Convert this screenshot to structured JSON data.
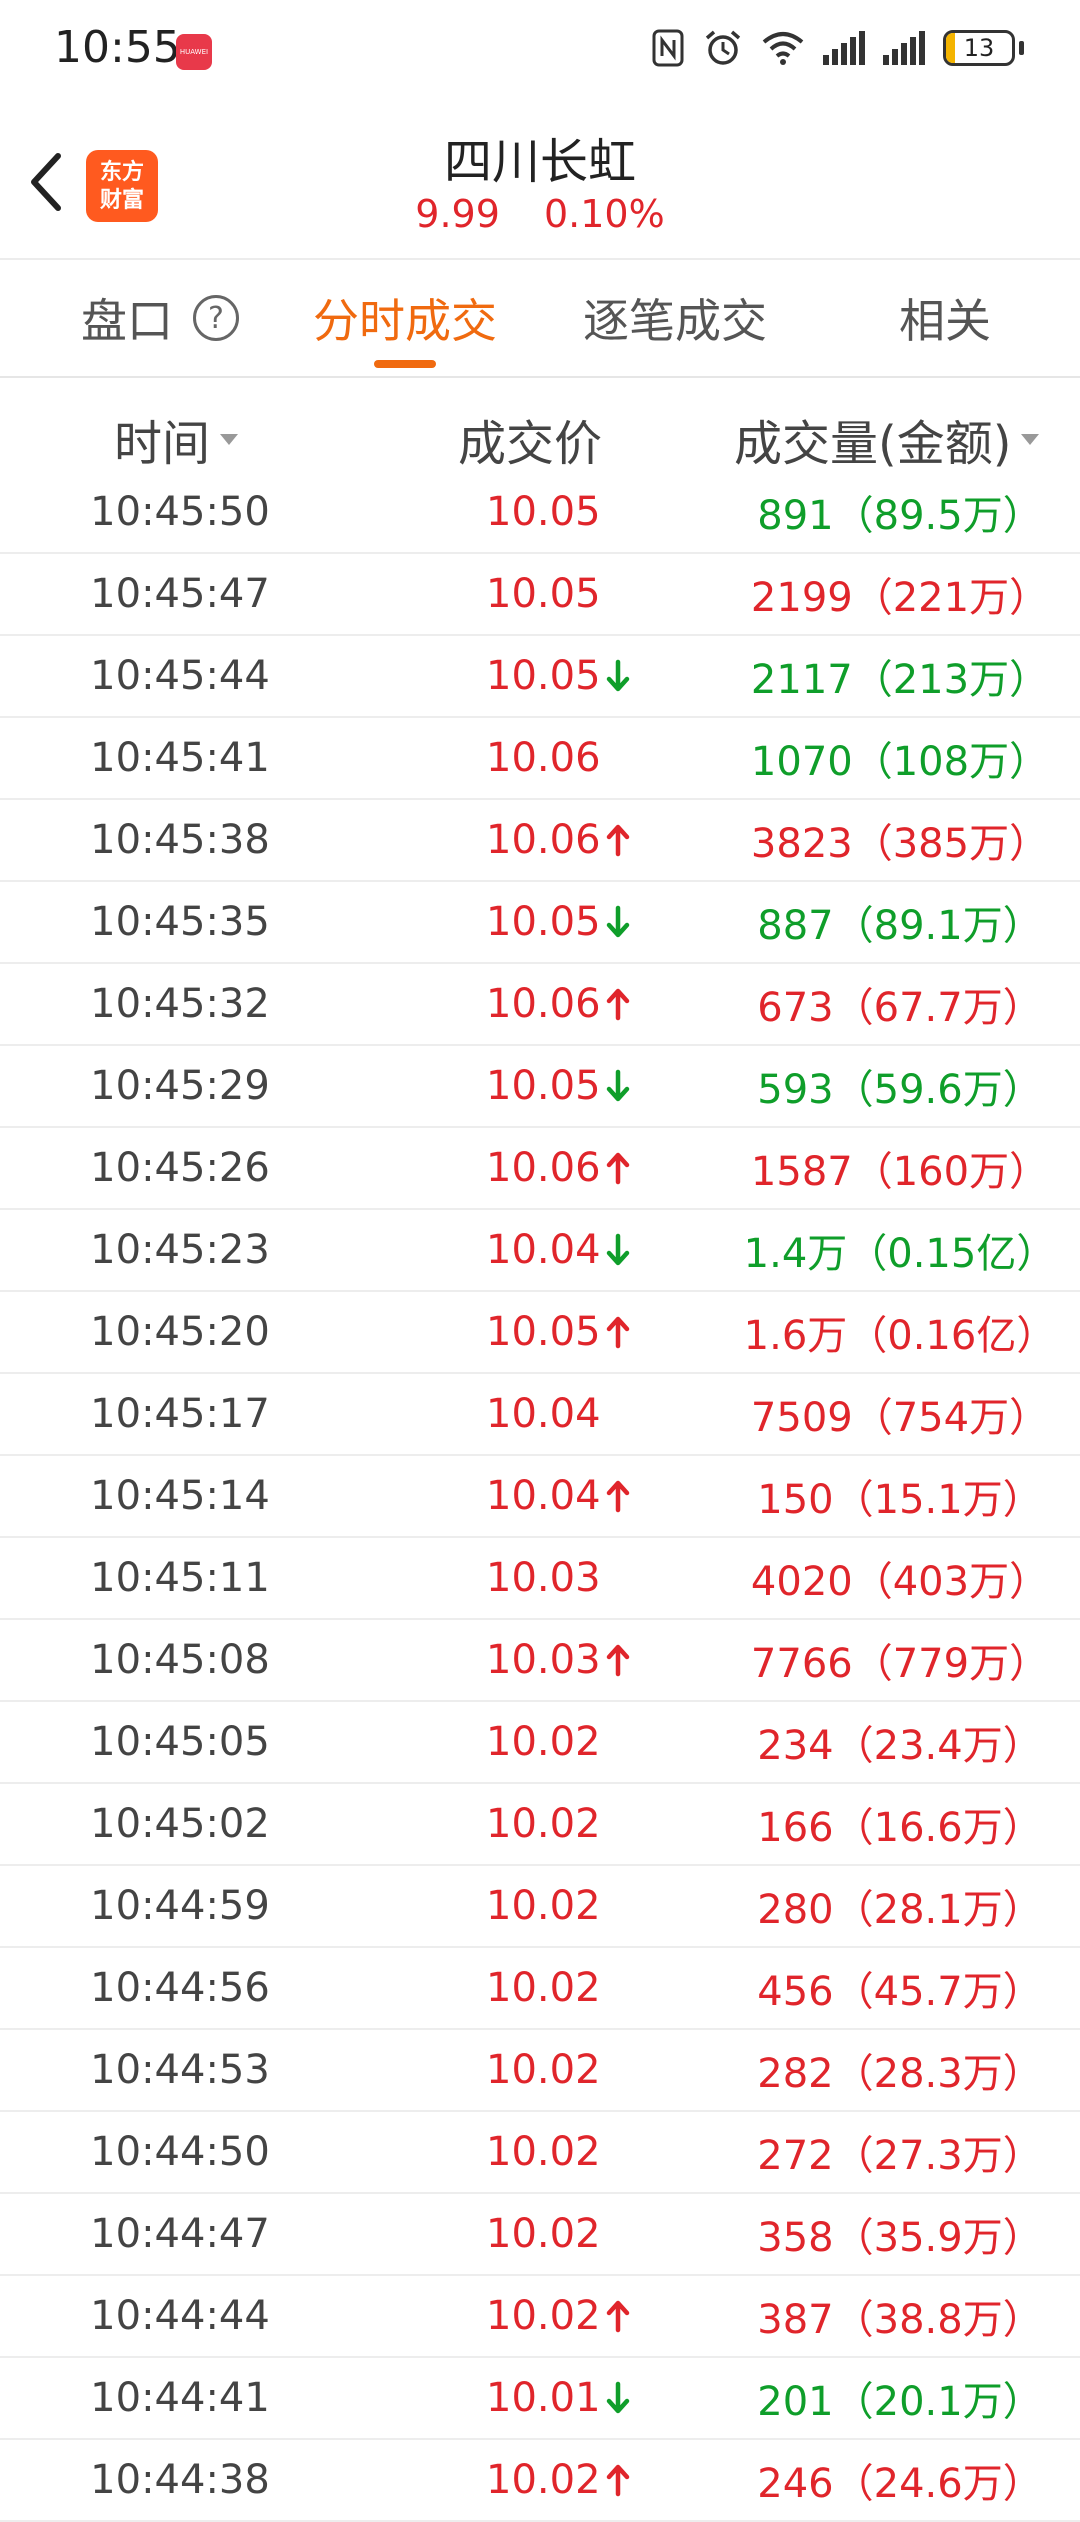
{
  "status_bar": {
    "time": "10:55",
    "huawei_badge": "HUAWEI",
    "battery": "13",
    "battery_level": 0.13
  },
  "header": {
    "logo_line1": "东方",
    "logo_line2": "财富",
    "stock_name": "四川长虹",
    "price": "9.99",
    "change_pct": "0.10%"
  },
  "tabs": [
    {
      "label": "盘口",
      "active": false
    },
    {
      "label": "分时成交",
      "active": true
    },
    {
      "label": "逐笔成交",
      "active": false
    },
    {
      "label": "相关",
      "active": false
    }
  ],
  "columns": {
    "time": "时间",
    "price": "成交价",
    "volume": "成交量(金额)"
  },
  "colors": {
    "up": "#e0252b",
    "down": "#0f9e2a",
    "accent": "#f06a0f"
  },
  "trades": [
    {
      "time": "10:45:50",
      "price": "10.05",
      "arrow": "",
      "volume": "891（89.5万）",
      "vol_color": "green"
    },
    {
      "time": "10:45:47",
      "price": "10.05",
      "arrow": "",
      "volume": "2199（221万）",
      "vol_color": "red"
    },
    {
      "time": "10:45:44",
      "price": "10.05",
      "arrow": "down",
      "volume": "2117（213万）",
      "vol_color": "green"
    },
    {
      "time": "10:45:41",
      "price": "10.06",
      "arrow": "",
      "volume": "1070（108万）",
      "vol_color": "green"
    },
    {
      "time": "10:45:38",
      "price": "10.06",
      "arrow": "up",
      "volume": "3823（385万）",
      "vol_color": "red"
    },
    {
      "time": "10:45:35",
      "price": "10.05",
      "arrow": "down",
      "volume": "887（89.1万）",
      "vol_color": "green"
    },
    {
      "time": "10:45:32",
      "price": "10.06",
      "arrow": "up",
      "volume": "673（67.7万）",
      "vol_color": "red"
    },
    {
      "time": "10:45:29",
      "price": "10.05",
      "arrow": "down",
      "volume": "593（59.6万）",
      "vol_color": "green"
    },
    {
      "time": "10:45:26",
      "price": "10.06",
      "arrow": "up",
      "volume": "1587（160万）",
      "vol_color": "red"
    },
    {
      "time": "10:45:23",
      "price": "10.04",
      "arrow": "down",
      "volume": "1.4万（0.15亿）",
      "vol_color": "green"
    },
    {
      "time": "10:45:20",
      "price": "10.05",
      "arrow": "up",
      "volume": "1.6万（0.16亿）",
      "vol_color": "red"
    },
    {
      "time": "10:45:17",
      "price": "10.04",
      "arrow": "",
      "volume": "7509（754万）",
      "vol_color": "red"
    },
    {
      "time": "10:45:14",
      "price": "10.04",
      "arrow": "up",
      "volume": "150（15.1万）",
      "vol_color": "red"
    },
    {
      "time": "10:45:11",
      "price": "10.03",
      "arrow": "",
      "volume": "4020（403万）",
      "vol_color": "red"
    },
    {
      "time": "10:45:08",
      "price": "10.03",
      "arrow": "up",
      "volume": "7766（779万）",
      "vol_color": "red"
    },
    {
      "time": "10:45:05",
      "price": "10.02",
      "arrow": "",
      "volume": "234（23.4万）",
      "vol_color": "red"
    },
    {
      "time": "10:45:02",
      "price": "10.02",
      "arrow": "",
      "volume": "166（16.6万）",
      "vol_color": "red"
    },
    {
      "time": "10:44:59",
      "price": "10.02",
      "arrow": "",
      "volume": "280（28.1万）",
      "vol_color": "red"
    },
    {
      "time": "10:44:56",
      "price": "10.02",
      "arrow": "",
      "volume": "456（45.7万）",
      "vol_color": "red"
    },
    {
      "time": "10:44:53",
      "price": "10.02",
      "arrow": "",
      "volume": "282（28.3万）",
      "vol_color": "red"
    },
    {
      "time": "10:44:50",
      "price": "10.02",
      "arrow": "",
      "volume": "272（27.3万）",
      "vol_color": "red"
    },
    {
      "time": "10:44:47",
      "price": "10.02",
      "arrow": "",
      "volume": "358（35.9万）",
      "vol_color": "red"
    },
    {
      "time": "10:44:44",
      "price": "10.02",
      "arrow": "up",
      "volume": "387（38.8万）",
      "vol_color": "red"
    },
    {
      "time": "10:44:41",
      "price": "10.01",
      "arrow": "down",
      "volume": "201（20.1万）",
      "vol_color": "green"
    },
    {
      "time": "10:44:38",
      "price": "10.02",
      "arrow": "up",
      "volume": "246（24.6万）",
      "vol_color": "red"
    }
  ]
}
